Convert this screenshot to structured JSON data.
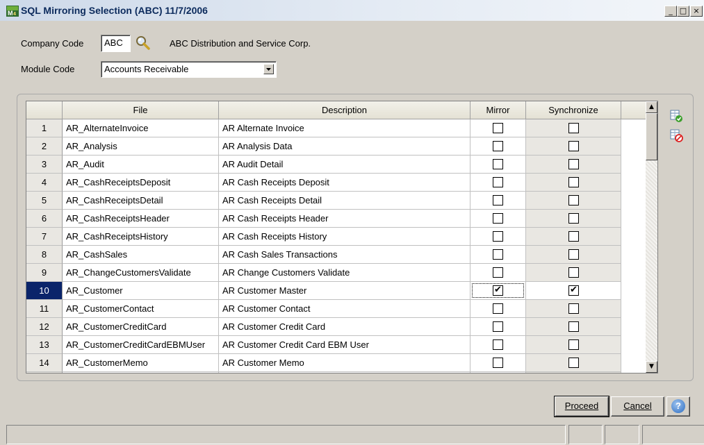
{
  "window": {
    "title": "SQL Mirroring Selection (ABC) 11/7/2006",
    "minimize": "_",
    "restore": "□",
    "close": "×"
  },
  "form": {
    "company_code_label": "Company Code",
    "company_code_value": "ABC",
    "company_name": "ABC Distribution and Service Corp.",
    "module_code_label": "Module Code",
    "module_code_value": "Accounts Receivable"
  },
  "grid": {
    "columns": [
      "File",
      "Description",
      "Mirror",
      "Synchronize"
    ],
    "rows": [
      {
        "num": "1",
        "file": "AR_AlternateInvoice",
        "desc": "AR Alternate Invoice",
        "mirror": false,
        "sync": false
      },
      {
        "num": "2",
        "file": "AR_Analysis",
        "desc": "AR Analysis Data",
        "mirror": false,
        "sync": false
      },
      {
        "num": "3",
        "file": "AR_Audit",
        "desc": "AR Audit Detail",
        "mirror": false,
        "sync": false
      },
      {
        "num": "4",
        "file": "AR_CashReceiptsDeposit",
        "desc": "AR Cash Receipts Deposit",
        "mirror": false,
        "sync": false
      },
      {
        "num": "5",
        "file": "AR_CashReceiptsDetail",
        "desc": "AR Cash Receipts Detail",
        "mirror": false,
        "sync": false
      },
      {
        "num": "6",
        "file": "AR_CashReceiptsHeader",
        "desc": "AR Cash Receipts Header",
        "mirror": false,
        "sync": false
      },
      {
        "num": "7",
        "file": "AR_CashReceiptsHistory",
        "desc": "AR Cash Receipts History",
        "mirror": false,
        "sync": false
      },
      {
        "num": "8",
        "file": "AR_CashSales",
        "desc": "AR Cash Sales Transactions",
        "mirror": false,
        "sync": false
      },
      {
        "num": "9",
        "file": "AR_ChangeCustomersValidate",
        "desc": "AR Change Customers Validate",
        "mirror": false,
        "sync": false
      },
      {
        "num": "10",
        "file": "AR_Customer",
        "desc": "AR Customer Master",
        "mirror": true,
        "sync": true,
        "selected": true
      },
      {
        "num": "11",
        "file": "AR_CustomerContact",
        "desc": "AR Customer Contact",
        "mirror": false,
        "sync": false
      },
      {
        "num": "12",
        "file": "AR_CustomerCreditCard",
        "desc": "AR Customer Credit Card",
        "mirror": false,
        "sync": false
      },
      {
        "num": "13",
        "file": "AR_CustomerCreditCardEBMUser",
        "desc": "AR Customer Credit Card EBM User",
        "mirror": false,
        "sync": false
      },
      {
        "num": "14",
        "file": "AR_CustomerMemo",
        "desc": "AR Customer Memo",
        "mirror": false,
        "sync": false
      }
    ]
  },
  "buttons": {
    "proceed": "Proceed",
    "cancel": "Cancel",
    "help": "?"
  },
  "icons": {
    "app": "mas-app-icon",
    "lookup": "magnifier-icon",
    "dropdown": "dropdown-arrow-icon",
    "select_all": "select-all-icon",
    "clear_all": "clear-all-icon"
  },
  "colors": {
    "selected_row_number": "#0a246a",
    "window_face": "#d4d0c8"
  }
}
